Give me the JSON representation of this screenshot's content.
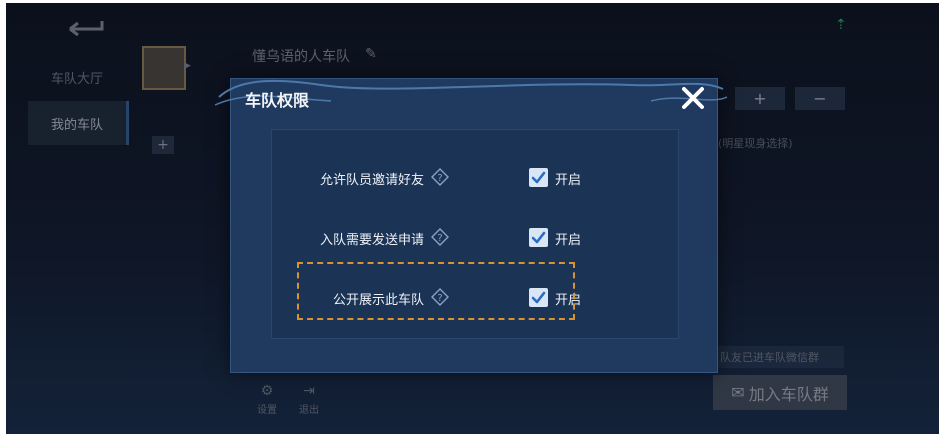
{
  "background": {
    "sidebar": {
      "items": [
        {
          "label": "车队大厅"
        },
        {
          "label": "我的车队"
        }
      ]
    },
    "team_name": "懂乌语的人车队",
    "add_label": "+",
    "plus_label": "+",
    "minus_label": "−",
    "right_note": "(明星现身选择)",
    "right_bar_text": "队友已进车队微信群",
    "join_button": {
      "label": "加入车队群",
      "icon": "wechat-icon"
    },
    "bottom_tools": [
      {
        "label": "设置",
        "icon": "gear-icon"
      },
      {
        "label": "退出",
        "icon": "exit-icon"
      }
    ]
  },
  "modal": {
    "title": "车队权限",
    "close_icon": "close-icon",
    "permissions": [
      {
        "label": "允许队员邀请好友",
        "checked": true,
        "state_label": "开启"
      },
      {
        "label": "入队需要发送申请",
        "checked": true,
        "state_label": "开启"
      },
      {
        "label": "公开展示此车队",
        "checked": true,
        "state_label": "开启",
        "highlighted": true
      }
    ]
  },
  "colors": {
    "modal_bg": "#1f3a5e",
    "panel_bg": "#1b3354",
    "checkbox_bg": "#d8e6f5",
    "check_mark": "#2b6cc2",
    "highlight_border": "#d8942f"
  }
}
